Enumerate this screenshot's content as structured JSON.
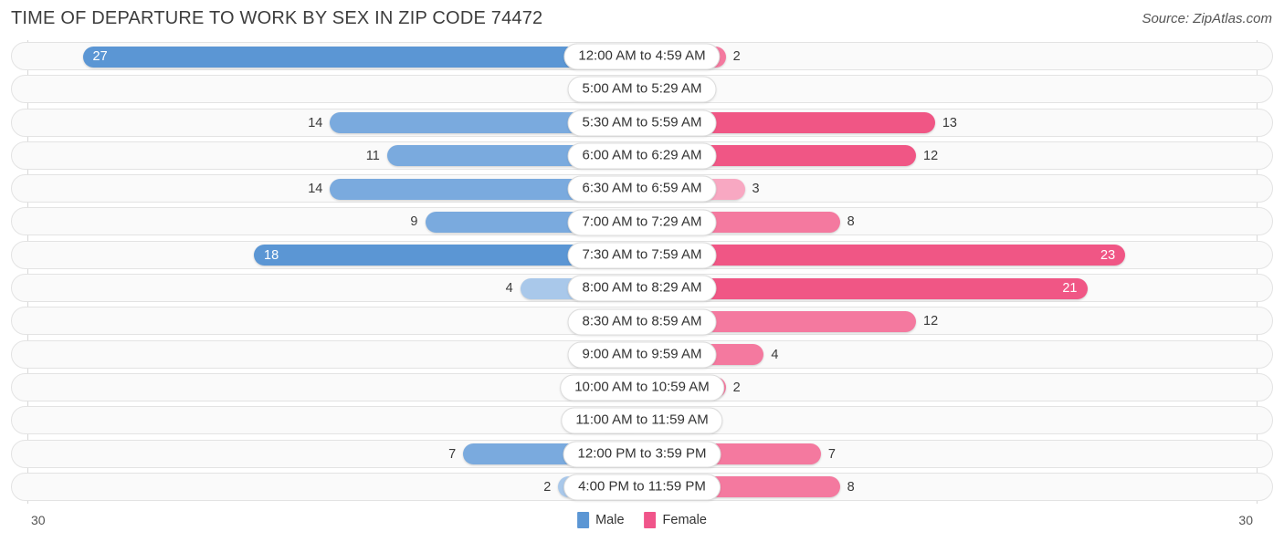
{
  "header": {
    "title": "TIME OF DEPARTURE TO WORK BY SEX IN ZIP CODE 74472",
    "source": "Source: ZipAtlas.com"
  },
  "footer": {
    "axis_min_label": "30",
    "axis_max_label": "30",
    "legend": [
      {
        "label": "Male",
        "color": "#5b96d4"
      },
      {
        "label": "Female",
        "color": "#f0558a"
      }
    ]
  },
  "colors": {
    "male": "#7aaade",
    "male_low": "#a9c8ea",
    "male_high": "#5b96d4",
    "female": "#f4799f",
    "female_low": "#f8a8c2",
    "female_high": "#f05685",
    "track": "#fafafa",
    "gridline": "#d8d8d8"
  },
  "chart_data": {
    "type": "bar",
    "title": "TIME OF DEPARTURE TO WORK BY SEX IN ZIP CODE 74472",
    "subtitle": "",
    "orientation": "horizontal-diverging",
    "xlabel": "",
    "ylabel": "",
    "xlim": [
      30,
      30
    ],
    "axis_max": 30,
    "grid": true,
    "legend_position": "bottom-center",
    "categories": [
      "12:00 AM to 4:59 AM",
      "5:00 AM to 5:29 AM",
      "5:30 AM to 5:59 AM",
      "6:00 AM to 6:29 AM",
      "6:30 AM to 6:59 AM",
      "7:00 AM to 7:29 AM",
      "7:30 AM to 7:59 AM",
      "8:00 AM to 8:29 AM",
      "8:30 AM to 8:59 AM",
      "9:00 AM to 9:59 AM",
      "10:00 AM to 10:59 AM",
      "11:00 AM to 11:59 AM",
      "12:00 PM to 3:59 PM",
      "4:00 PM to 11:59 PM"
    ],
    "series": [
      {
        "name": "Male",
        "color": "#5b96d4",
        "values": [
          27,
          0,
          14,
          11,
          14,
          9,
          18,
          4,
          0,
          0,
          0,
          0,
          7,
          2
        ]
      },
      {
        "name": "Female",
        "color": "#f0558a",
        "values": [
          2,
          0,
          13,
          12,
          3,
          8,
          23,
          21,
          12,
          4,
          2,
          0,
          7,
          8
        ]
      }
    ]
  },
  "rows": [
    {
      "label": "12:00 AM to 4:59 AM",
      "male": "27",
      "female": "2",
      "male_val": 27,
      "female_val": 2,
      "male_tone": "hi",
      "female_tone": "mid",
      "male_inside": true,
      "female_inside": false
    },
    {
      "label": "5:00 AM to 5:29 AM",
      "male": "0",
      "female": "0",
      "male_val": 0,
      "female_val": 0,
      "male_tone": "lo",
      "female_tone": "lo",
      "male_inside": false,
      "female_inside": false
    },
    {
      "label": "5:30 AM to 5:59 AM",
      "male": "14",
      "female": "13",
      "male_val": 14,
      "female_val": 13,
      "male_tone": "mid",
      "female_tone": "hi",
      "male_inside": false,
      "female_inside": false
    },
    {
      "label": "6:00 AM to 6:29 AM",
      "male": "11",
      "female": "12",
      "male_val": 11,
      "female_val": 12,
      "male_tone": "mid",
      "female_tone": "hi",
      "male_inside": false,
      "female_inside": false
    },
    {
      "label": "6:30 AM to 6:59 AM",
      "male": "14",
      "female": "3",
      "male_val": 14,
      "female_val": 3,
      "male_tone": "mid",
      "female_tone": "lo",
      "male_inside": false,
      "female_inside": false
    },
    {
      "label": "7:00 AM to 7:29 AM",
      "male": "9",
      "female": "8",
      "male_val": 9,
      "female_val": 8,
      "male_tone": "mid",
      "female_tone": "mid",
      "male_inside": false,
      "female_inside": false
    },
    {
      "label": "7:30 AM to 7:59 AM",
      "male": "18",
      "female": "23",
      "male_val": 18,
      "female_val": 23,
      "male_tone": "hi",
      "female_tone": "hi",
      "male_inside": true,
      "female_inside": true
    },
    {
      "label": "8:00 AM to 8:29 AM",
      "male": "4",
      "female": "21",
      "male_val": 4,
      "female_val": 21,
      "male_tone": "lo",
      "female_tone": "hi",
      "male_inside": false,
      "female_inside": true
    },
    {
      "label": "8:30 AM to 8:59 AM",
      "male": "0",
      "female": "12",
      "male_val": 0,
      "female_val": 12,
      "male_tone": "lo",
      "female_tone": "mid",
      "male_inside": false,
      "female_inside": false
    },
    {
      "label": "9:00 AM to 9:59 AM",
      "male": "0",
      "female": "4",
      "male_val": 0,
      "female_val": 4,
      "male_tone": "lo",
      "female_tone": "mid",
      "male_inside": false,
      "female_inside": false
    },
    {
      "label": "10:00 AM to 10:59 AM",
      "male": "0",
      "female": "2",
      "male_val": 0,
      "female_val": 2,
      "male_tone": "lo",
      "female_tone": "mid",
      "male_inside": false,
      "female_inside": false
    },
    {
      "label": "11:00 AM to 11:59 AM",
      "male": "0",
      "female": "0",
      "male_val": 0,
      "female_val": 0,
      "male_tone": "lo",
      "female_tone": "lo",
      "male_inside": false,
      "female_inside": false
    },
    {
      "label": "12:00 PM to 3:59 PM",
      "male": "7",
      "female": "7",
      "male_val": 7,
      "female_val": 7,
      "male_tone": "mid",
      "female_tone": "mid",
      "male_inside": false,
      "female_inside": false
    },
    {
      "label": "4:00 PM to 11:59 PM",
      "male": "2",
      "female": "8",
      "male_val": 2,
      "female_val": 8,
      "male_tone": "lo",
      "female_tone": "mid",
      "male_inside": false,
      "female_inside": false
    }
  ]
}
